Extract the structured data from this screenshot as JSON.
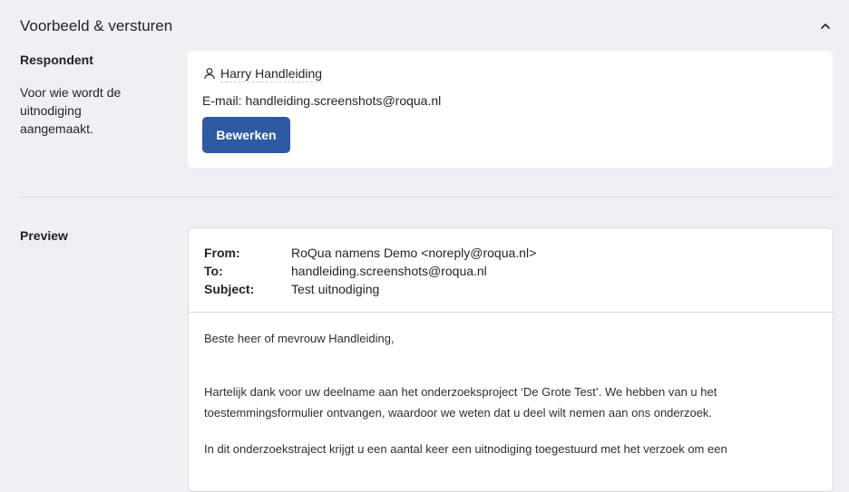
{
  "section": {
    "title": "Voorbeeld & versturen",
    "collapse_icon": "chevron-up-icon"
  },
  "respondent": {
    "label": "Respondent",
    "description": "Voor wie wordt de uitnodiging aangemaakt.",
    "person_icon": "user-icon",
    "name": "Harry Handleiding",
    "email_line": "E-mail: handleiding.screenshots@roqua.nl",
    "edit_button": "Bewerken",
    "button_color": "#2d5aa0"
  },
  "preview": {
    "label": "Preview",
    "headers": [
      {
        "key": "From:",
        "value": "RoQua namens Demo <noreply@roqua.nl>"
      },
      {
        "key": "To:",
        "value": "handleiding.screenshots@roqua.nl"
      },
      {
        "key": "Subject:",
        "value": "Test uitnodiging"
      }
    ],
    "body": {
      "greeting": "Beste heer of mevrouw Handleiding,",
      "para1_line1": "Hartelijk dank voor uw deelname aan het onderzoeksproject ‘De Grote Test’. We hebben van u het",
      "para1_line2": "toestemmingsformulier ontvangen, waardoor we weten dat u deel wilt nemen aan ons onderzoek.",
      "para2_line1": "In dit onderzoekstraject krijgt u een aantal keer een uitnodiging toegestuurd met het verzoek om een"
    }
  }
}
